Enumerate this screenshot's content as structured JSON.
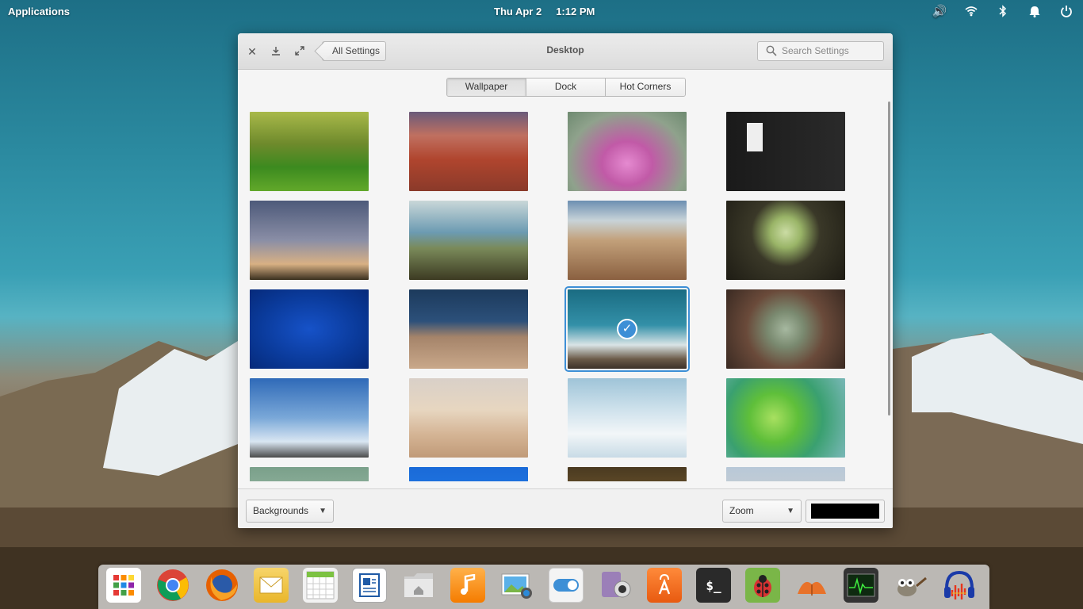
{
  "panel": {
    "applications": "Applications",
    "date": "Thu Apr  2",
    "time": "1:12 PM"
  },
  "window": {
    "title": "Desktop",
    "back_label": "All Settings",
    "search_placeholder": "Search Settings",
    "tabs": [
      {
        "label": "Wallpaper",
        "active": true
      },
      {
        "label": "Dock",
        "active": false
      },
      {
        "label": "Hot Corners",
        "active": false
      }
    ],
    "footer": {
      "source_label": "Backgrounds",
      "mode_label": "Zoom",
      "color": "#000000"
    }
  },
  "colors": {
    "accent": "#3d8fd6"
  }
}
